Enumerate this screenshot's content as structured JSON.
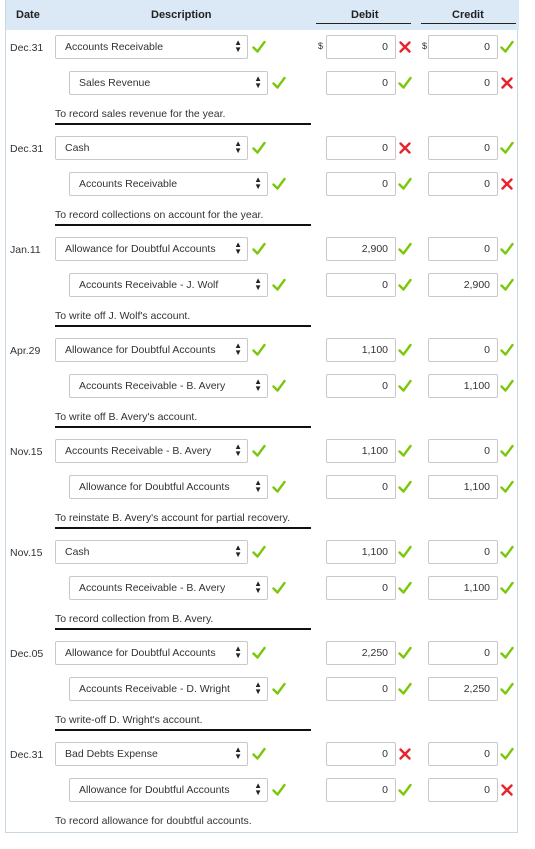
{
  "header": {
    "date": "Date",
    "description": "Description",
    "debit": "Debit",
    "credit": "Credit"
  },
  "currency": "$",
  "entries": [
    {
      "date": "Dec.31",
      "memo": "To record sales revenue for the year.",
      "lines": [
        {
          "account": "Accounts Receivable",
          "account_ok": true,
          "debit": "0",
          "debit_ok": false,
          "credit": "0",
          "credit_ok": true
        },
        {
          "account": "Sales Revenue",
          "account_ok": true,
          "debit": "0",
          "debit_ok": true,
          "credit": "0",
          "credit_ok": false
        }
      ]
    },
    {
      "date": "Dec.31",
      "memo": "To record collections on account for the year.",
      "lines": [
        {
          "account": "Cash",
          "account_ok": true,
          "debit": "0",
          "debit_ok": false,
          "credit": "0",
          "credit_ok": true
        },
        {
          "account": "Accounts Receivable",
          "account_ok": true,
          "debit": "0",
          "debit_ok": true,
          "credit": "0",
          "credit_ok": false
        }
      ]
    },
    {
      "date": "Jan.11",
      "memo": "To write off J. Wolf's account.",
      "lines": [
        {
          "account": "Allowance for Doubtful Accounts",
          "account_ok": true,
          "debit": "2,900",
          "debit_ok": true,
          "credit": "0",
          "credit_ok": true
        },
        {
          "account": "Accounts Receivable - J. Wolf",
          "account_ok": true,
          "debit": "0",
          "debit_ok": true,
          "credit": "2,900",
          "credit_ok": true
        }
      ]
    },
    {
      "date": "Apr.29",
      "memo": "To write off B. Avery's account.",
      "lines": [
        {
          "account": "Allowance for Doubtful Accounts",
          "account_ok": true,
          "debit": "1,100",
          "debit_ok": true,
          "credit": "0",
          "credit_ok": true
        },
        {
          "account": "Accounts Receivable - B. Avery",
          "account_ok": true,
          "debit": "0",
          "debit_ok": true,
          "credit": "1,100",
          "credit_ok": true
        }
      ]
    },
    {
      "date": "Nov.15",
      "memo": "To reinstate B. Avery's account for partial recovery.",
      "lines": [
        {
          "account": "Accounts Receivable - B. Avery",
          "account_ok": true,
          "debit": "1,100",
          "debit_ok": true,
          "credit": "0",
          "credit_ok": true
        },
        {
          "account": "Allowance for Doubtful Accounts",
          "account_ok": true,
          "debit": "0",
          "debit_ok": true,
          "credit": "1,100",
          "credit_ok": true
        }
      ]
    },
    {
      "date": "Nov.15",
      "memo": "To record collection from B. Avery.",
      "lines": [
        {
          "account": "Cash",
          "account_ok": true,
          "debit": "1,100",
          "debit_ok": true,
          "credit": "0",
          "credit_ok": true
        },
        {
          "account": "Accounts Receivable - B. Avery",
          "account_ok": true,
          "debit": "0",
          "debit_ok": true,
          "credit": "1,100",
          "credit_ok": true
        }
      ]
    },
    {
      "date": "Dec.05",
      "memo": "To write-off D. Wright's account.",
      "lines": [
        {
          "account": "Allowance for Doubtful Accounts",
          "account_ok": true,
          "debit": "2,250",
          "debit_ok": true,
          "credit": "0",
          "credit_ok": true
        },
        {
          "account": "Accounts Receivable - D. Wright",
          "account_ok": true,
          "debit": "0",
          "debit_ok": true,
          "credit": "2,250",
          "credit_ok": true
        }
      ]
    },
    {
      "date": "Dec.31",
      "memo": "To record allowance for doubtful accounts.",
      "lines": [
        {
          "account": "Bad Debts Expense",
          "account_ok": true,
          "debit": "0",
          "debit_ok": false,
          "credit": "0",
          "credit_ok": true
        },
        {
          "account": "Allowance for Doubtful Accounts",
          "account_ok": true,
          "debit": "0",
          "debit_ok": true,
          "credit": "0",
          "credit_ok": false
        }
      ]
    }
  ],
  "colors": {
    "header_bg": "#dbe8f5",
    "check": "#7ac70c",
    "cross": "#e8232d"
  },
  "icons": {
    "correct": "check-icon",
    "incorrect": "cross-icon",
    "select_arrow": "updown-arrow-icon"
  }
}
